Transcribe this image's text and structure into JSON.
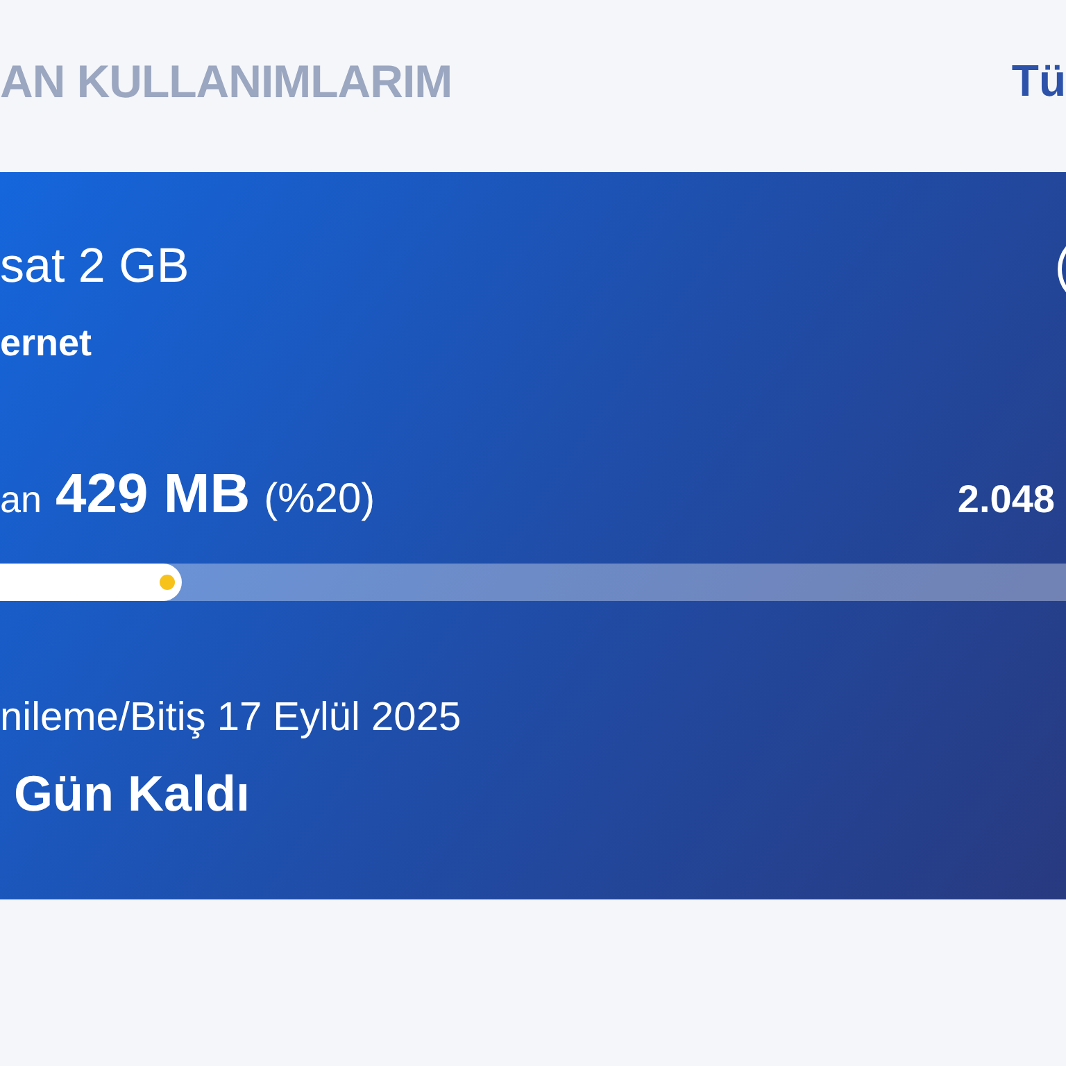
{
  "header": {
    "title": "AN KULLANIMLARIM",
    "link": "Tü"
  },
  "card": {
    "plan_name": "sat 2 GB",
    "category": "ernet",
    "usage": {
      "label": "an",
      "amount": "429 MB",
      "percent": "(%20)",
      "total": "2.048",
      "level": 0.17
    },
    "renewal": "nileme/Bitiş 17 Eylül 2025",
    "days_left": "Gün Kaldı"
  }
}
